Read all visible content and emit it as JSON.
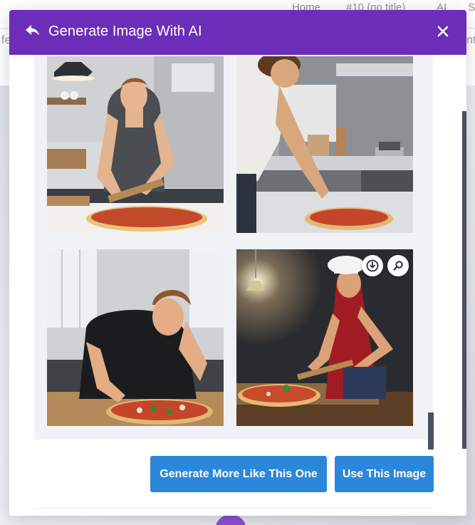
{
  "background": {
    "nav": [
      "Home",
      "#10 (no title)",
      "AI",
      "S"
    ],
    "edge_left": "fe",
    "edge_right": "nt"
  },
  "modal": {
    "title": "Generate Image With AI",
    "icons": {
      "back": "undo-arrow-icon",
      "close": "close-icon",
      "download": "download-icon",
      "zoom": "magnifier-icon"
    },
    "images": [
      {
        "name": "generated-image-1",
        "alt": "Man in grey polo cutting pizza with wooden peel"
      },
      {
        "name": "generated-image-2",
        "alt": "Man in white shirt sprinkling toppings on pizza"
      },
      {
        "name": "generated-image-3",
        "alt": "Man in black shirt slicing pizza"
      },
      {
        "name": "generated-image-4",
        "alt": "Chef in red shirt and white hat holding pizza peel"
      }
    ],
    "buttons": {
      "generate_more": "Generate More Like This One",
      "use_image": "Use This Image"
    },
    "colors": {
      "header": "#6c2eb9",
      "button": "#2b87da"
    }
  }
}
